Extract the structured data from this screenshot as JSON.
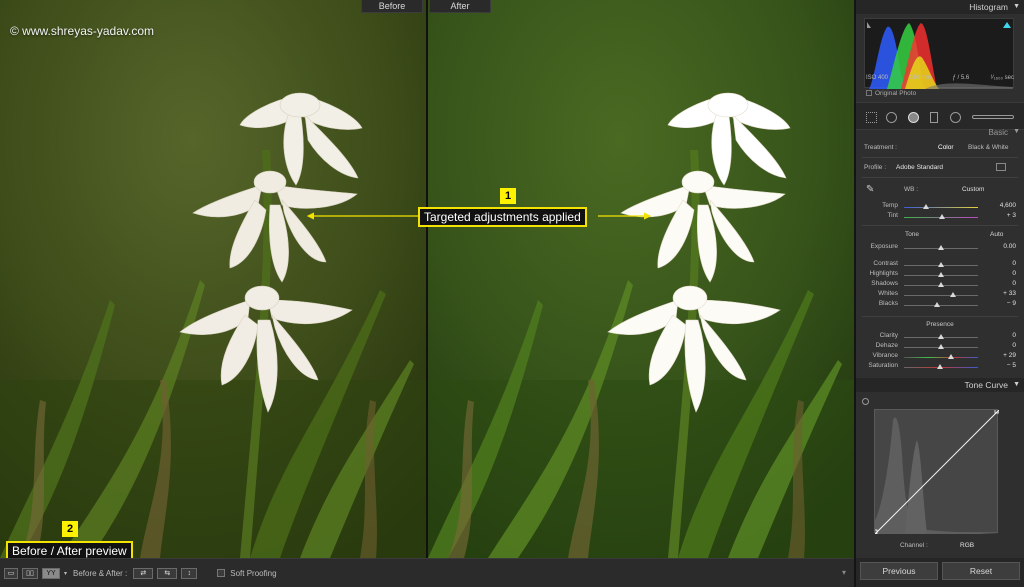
{
  "preview": {
    "before_label": "Before",
    "after_label": "After",
    "watermark": "© www.shreyas-yadav.com",
    "callout_1": {
      "number": "1",
      "text": "Targeted adjustments applied"
    },
    "callout_2": {
      "number": "2",
      "text": "Before / After preview"
    }
  },
  "toolbar": {
    "view_buttons": [
      "▭",
      "▯▯",
      "YY"
    ],
    "before_after_label": "Before & After :",
    "soft_proofing_label": "Soft Proofing"
  },
  "panel": {
    "histogram": {
      "title": "Histogram",
      "iso": "ISO 400",
      "focal": "310 mm",
      "aperture": "ƒ / 5.6",
      "shutter": "¹⁄₁₆₀₀ sec",
      "original_photo": "Original Photo"
    },
    "basic": {
      "title": "Basic",
      "treatment_label": "Treatment :",
      "treatment_color": "Color",
      "treatment_bw": "Black & White",
      "profile_label": "Profile :",
      "profile_value": "Adobe Standard",
      "wb_label": "WB :",
      "wb_value": "Custom",
      "tone_label": "Tone",
      "auto_label": "Auto",
      "presence_label": "Presence",
      "sliders": [
        {
          "label": "Temp",
          "value": "4,600",
          "pos": 0.3
        },
        {
          "label": "Tint",
          "value": "+ 3",
          "pos": 0.52
        },
        {
          "label": "Exposure",
          "value": "0.00",
          "pos": 0.5
        },
        {
          "label": "Contrast",
          "value": "0",
          "pos": 0.5
        },
        {
          "label": "Highlights",
          "value": "0",
          "pos": 0.5
        },
        {
          "label": "Shadows",
          "value": "0",
          "pos": 0.5
        },
        {
          "label": "Whites",
          "value": "+ 33",
          "pos": 0.66
        },
        {
          "label": "Blacks",
          "value": "− 9",
          "pos": 0.45
        },
        {
          "label": "Clarity",
          "value": "0",
          "pos": 0.5
        },
        {
          "label": "Dehaze",
          "value": "0",
          "pos": 0.5
        },
        {
          "label": "Vibrance",
          "value": "+ 29",
          "pos": 0.64
        },
        {
          "label": "Saturation",
          "value": "− 5",
          "pos": 0.48
        }
      ]
    },
    "tone_curve": {
      "title": "Tone Curve",
      "channel_label": "Channel :",
      "channel_value": "RGB"
    },
    "buttons": {
      "previous": "Previous",
      "reset": "Reset"
    }
  },
  "colors": {
    "callout_border": "#f3e300",
    "callout_number_bg": "#fff200"
  }
}
